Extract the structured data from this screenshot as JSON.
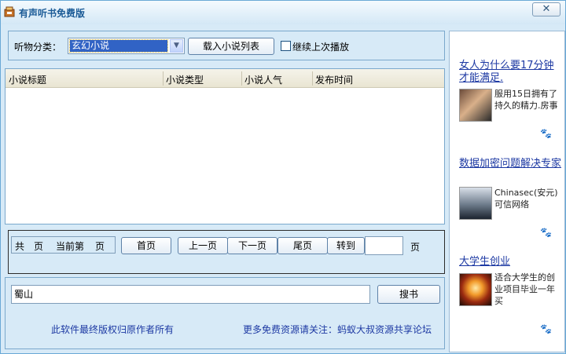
{
  "window": {
    "title": "有声听书免费版",
    "close_label": "✕"
  },
  "category": {
    "label": "听物分类：",
    "selected": "玄幻小说",
    "load_button": "载入小说列表",
    "continue_label": "继续上次播放"
  },
  "list": {
    "columns": [
      "小说标题",
      "小说类型",
      "小说人气",
      "发布时间"
    ],
    "rows": []
  },
  "pager": {
    "gong": "共",
    "ye": "页",
    "current": "当前第",
    "ye2": "页",
    "first": "首页",
    "prev": "上一页",
    "next": "下一页",
    "last": "尾页",
    "goto": "转到",
    "goto_value": "",
    "unit": "页"
  },
  "search": {
    "value": "蜀山",
    "button": "搜书"
  },
  "footer": {
    "copyright": "此软件最终版权归原作者所有",
    "more": "更多免费资源请关注：蚂蚁大叔资源共享论坛"
  },
  "ads": [
    {
      "title": "女人为什么要17分钟才能满足.",
      "text": "服用15日拥有了持久的精力.房事",
      "icon": "paw-icon"
    },
    {
      "title": "数据加密问题解决专家",
      "text": "Chinasec(安元)可信网络",
      "icon": "paw-icon"
    },
    {
      "title": "大学生创业",
      "text": "适合大学生的创业项目毕业一年买",
      "icon": "paw-icon"
    }
  ],
  "colors": {
    "accent": "#3163c5",
    "link": "#1d39a3",
    "title": "#1a5a96"
  }
}
